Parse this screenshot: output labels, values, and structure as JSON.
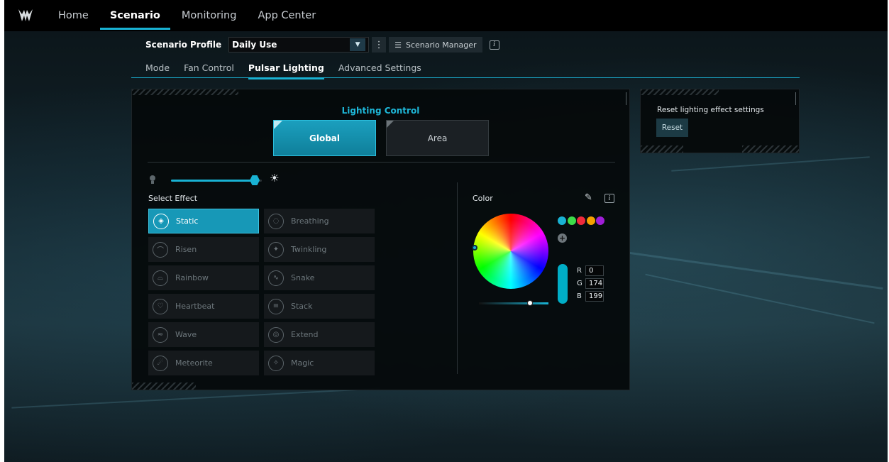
{
  "nav": {
    "items": [
      {
        "label": "Home",
        "active": false
      },
      {
        "label": "Scenario",
        "active": true
      },
      {
        "label": "Monitoring",
        "active": false
      },
      {
        "label": "App Center",
        "active": false
      }
    ]
  },
  "profile": {
    "label": "Scenario Profile",
    "selected": "Daily Use",
    "manager_label": "Scenario Manager"
  },
  "subtabs": [
    {
      "label": "Mode",
      "active": false
    },
    {
      "label": "Fan Control",
      "active": false
    },
    {
      "label": "Pulsar Lighting",
      "active": true
    },
    {
      "label": "Advanced Settings",
      "active": false
    }
  ],
  "lighting": {
    "title": "Lighting Control",
    "global_label": "Global",
    "area_label": "Area",
    "selected_mode": "Global",
    "brightness": 0.9,
    "effect_title": "Select Effect",
    "effects": [
      {
        "label": "Static",
        "icon": "static-icon",
        "active": true
      },
      {
        "label": "Breathing",
        "icon": "breathing-icon",
        "active": false
      },
      {
        "label": "Risen",
        "icon": "risen-icon",
        "active": false
      },
      {
        "label": "Twinkling",
        "icon": "twinkling-icon",
        "active": false
      },
      {
        "label": "Rainbow",
        "icon": "rainbow-icon",
        "active": false
      },
      {
        "label": "Snake",
        "icon": "snake-icon",
        "active": false
      },
      {
        "label": "Heartbeat",
        "icon": "heartbeat-icon",
        "active": false
      },
      {
        "label": "Stack",
        "icon": "stack-icon",
        "active": false
      },
      {
        "label": "Wave",
        "icon": "wave-icon",
        "active": false
      },
      {
        "label": "Extend",
        "icon": "extend-icon",
        "active": false
      },
      {
        "label": "Meteorite",
        "icon": "meteorite-icon",
        "active": false
      },
      {
        "label": "Magic",
        "icon": "magic-icon",
        "active": false
      }
    ]
  },
  "color": {
    "title": "Color",
    "swatches": [
      "#19b2d3",
      "#3ddc4a",
      "#f02a3c",
      "#f5a000",
      "#a01ed8"
    ],
    "r_label": "R",
    "g_label": "G",
    "b_label": "B",
    "r": "0",
    "g": "174",
    "b": "199",
    "current": "#00aec7"
  },
  "reset": {
    "title": "Reset lighting effect settings",
    "button_label": "Reset"
  },
  "colors": {
    "accent": "#19b2d3"
  }
}
